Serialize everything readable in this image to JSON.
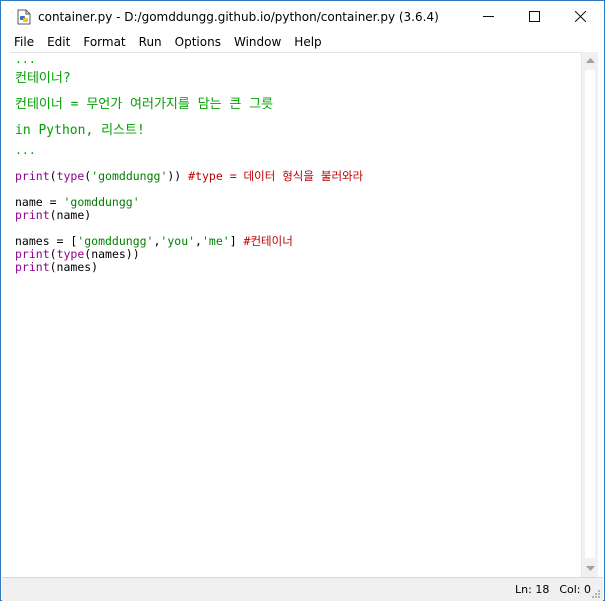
{
  "window": {
    "title": "container.py - D:/gomddungg.github.io/python/container.py (3.6.4)",
    "minimize_glyph": "—",
    "maximize_glyph": "☐",
    "close_glyph": "✕"
  },
  "menu": {
    "items": [
      "File",
      "Edit",
      "Format",
      "Run",
      "Options",
      "Window",
      "Help"
    ]
  },
  "editor": {
    "lines": [
      {
        "parts": [
          {
            "t": "...",
            "c": "grn"
          }
        ]
      },
      {
        "big": true,
        "parts": [
          {
            "t": "컨테이너?",
            "c": "grn"
          }
        ]
      },
      {
        "big": true,
        "parts": [
          {
            "t": "컨테이너 = 무언가 여러가지를 담는 큰 그릇",
            "c": "grn"
          }
        ]
      },
      {
        "big": true,
        "parts": [
          {
            "t": "in Python, 리스트!",
            "c": "grn"
          }
        ]
      },
      {
        "parts": [
          {
            "t": "...",
            "c": "grn"
          }
        ]
      },
      {
        "parts": [
          {
            "t": " ",
            "c": "txt"
          }
        ]
      },
      {
        "parts": [
          {
            "t": "print",
            "c": "kw"
          },
          {
            "t": "(",
            "c": "txt"
          },
          {
            "t": "type",
            "c": "kw"
          },
          {
            "t": "(",
            "c": "txt"
          },
          {
            "t": "'gomddungg'",
            "c": "str"
          },
          {
            "t": ")) ",
            "c": "txt"
          },
          {
            "t": "#type = 데이터 형식을 불러와라",
            "c": "cm"
          }
        ]
      },
      {
        "parts": [
          {
            "t": " ",
            "c": "txt"
          }
        ]
      },
      {
        "parts": [
          {
            "t": "name = ",
            "c": "txt"
          },
          {
            "t": "'gomddungg'",
            "c": "str"
          }
        ]
      },
      {
        "parts": [
          {
            "t": "print",
            "c": "kw"
          },
          {
            "t": "(name)",
            "c": "txt"
          }
        ]
      },
      {
        "parts": [
          {
            "t": " ",
            "c": "txt"
          }
        ]
      },
      {
        "parts": [
          {
            "t": "names = [",
            "c": "txt"
          },
          {
            "t": "'gomddungg'",
            "c": "str"
          },
          {
            "t": ",",
            "c": "txt"
          },
          {
            "t": "'you'",
            "c": "str"
          },
          {
            "t": ",",
            "c": "txt"
          },
          {
            "t": "'me'",
            "c": "str"
          },
          {
            "t": "] ",
            "c": "txt"
          },
          {
            "t": "#컨테이너",
            "c": "cm"
          }
        ]
      },
      {
        "parts": [
          {
            "t": "print",
            "c": "kw"
          },
          {
            "t": "(",
            "c": "txt"
          },
          {
            "t": "type",
            "c": "kw"
          },
          {
            "t": "(names))",
            "c": "txt"
          }
        ]
      },
      {
        "parts": [
          {
            "t": "print",
            "c": "kw"
          },
          {
            "t": "(names)",
            "c": "txt"
          }
        ]
      }
    ]
  },
  "status": {
    "line": "Ln: 18",
    "col": "Col: 0"
  },
  "colors": {
    "keyword": "#900090",
    "string": "#008000",
    "comment": "#c00000",
    "docstring": "#00a000"
  },
  "icons": {
    "app": "python-file-icon",
    "scroll_up": "arrow-up-icon",
    "scroll_down": "arrow-down-icon"
  }
}
